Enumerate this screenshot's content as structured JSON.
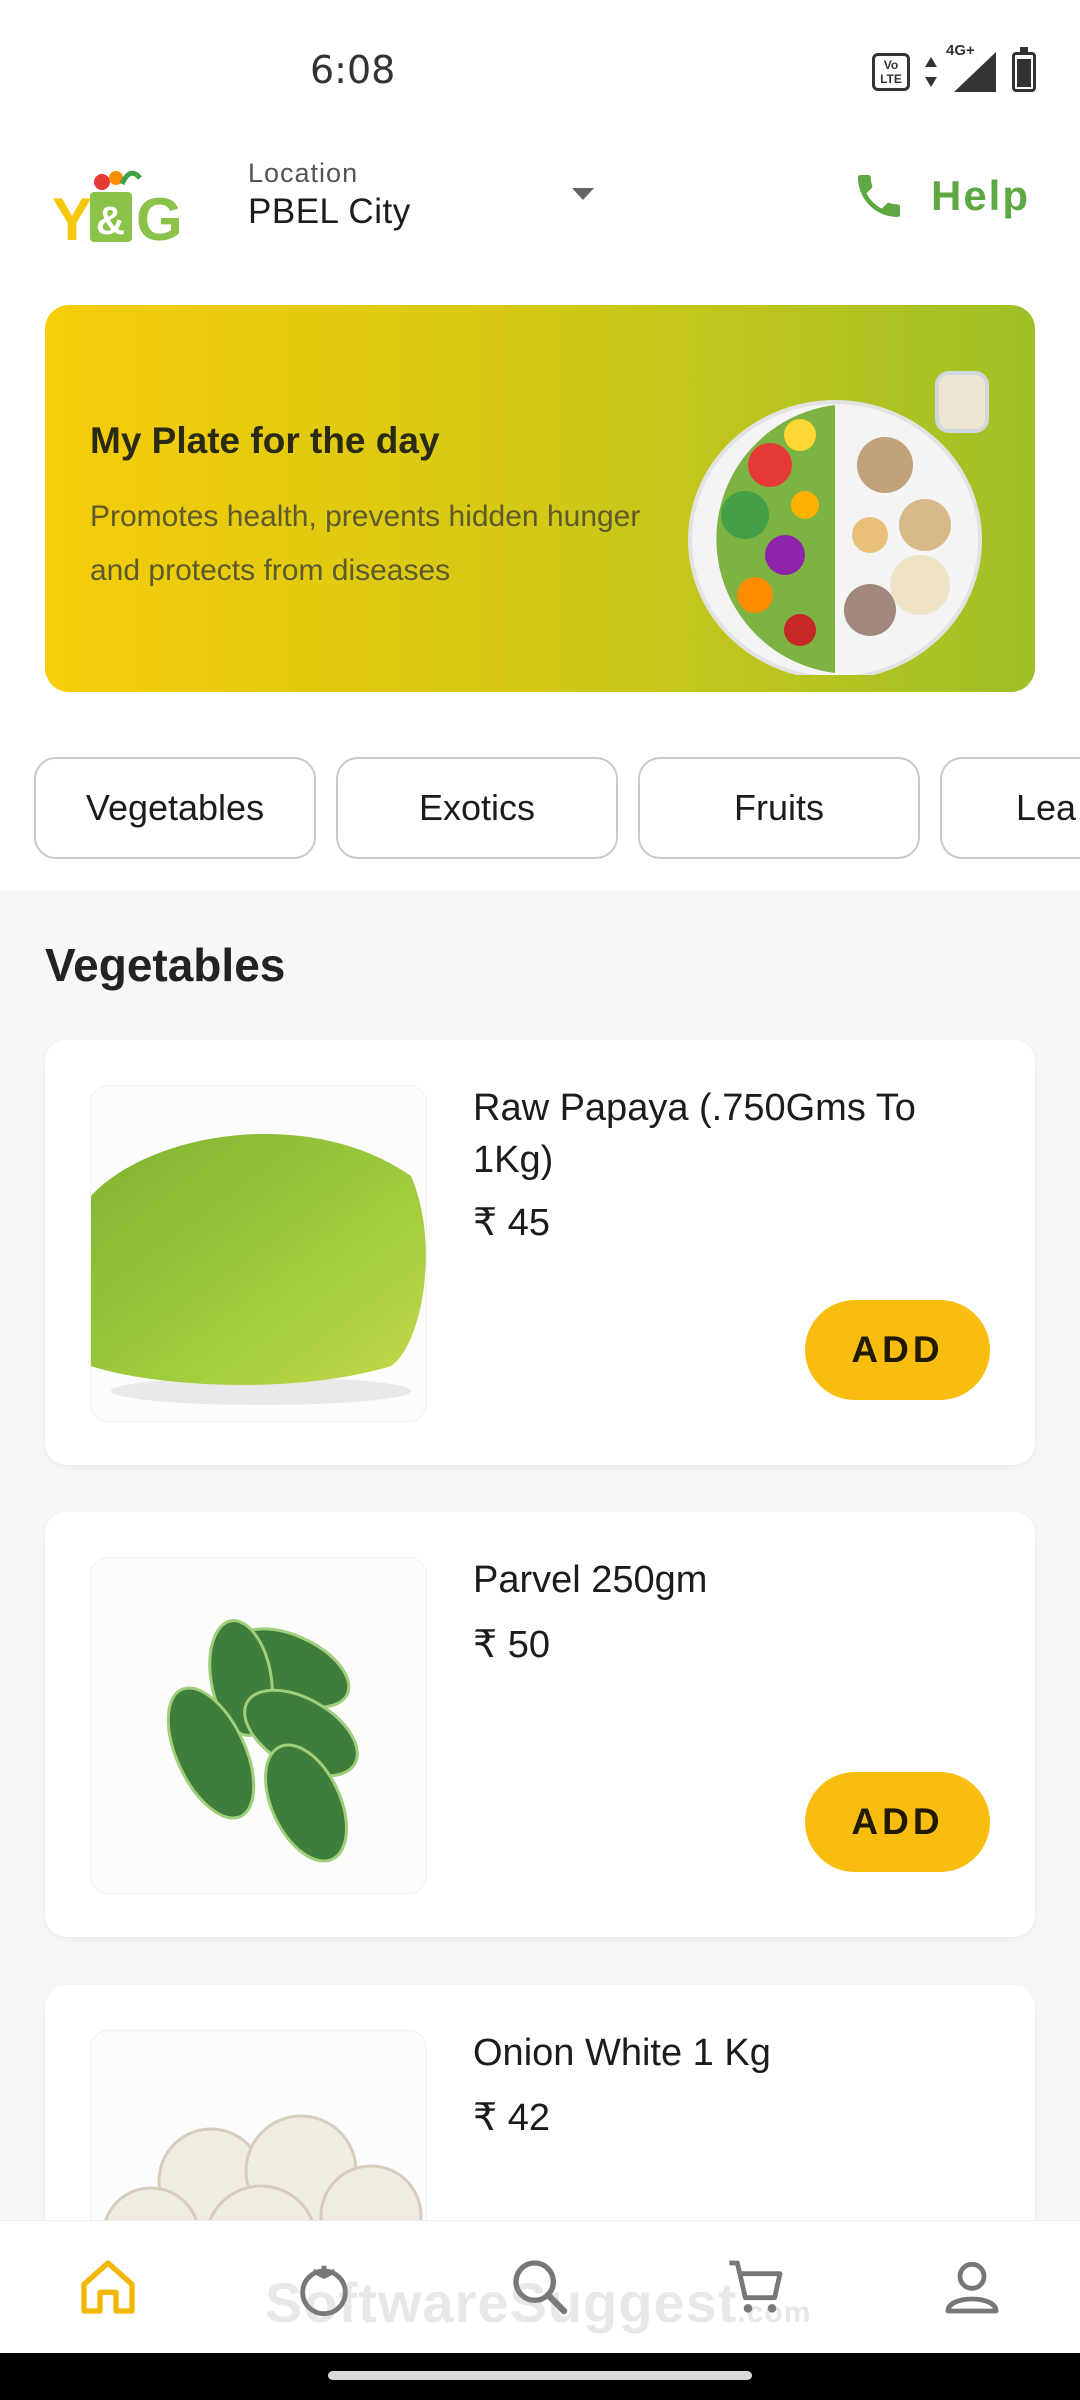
{
  "status_bar": {
    "time": "6:08",
    "network": "4G+",
    "volte_label": "Vo LTE",
    "icons": [
      "volte-icon",
      "data-arrows-icon",
      "signal-icon",
      "battery-icon"
    ]
  },
  "header": {
    "logo_text": "Y&G",
    "location_label": "Location",
    "location_value": "PBEL City",
    "help_label": "Help",
    "icons": [
      "logo",
      "caret-down-icon",
      "phone-icon"
    ],
    "accent_color": "#5ea843"
  },
  "banner": {
    "title": "My Plate for the day",
    "subtitle": "Promotes health, prevents hidden hunger and protects from diseases",
    "gradient": [
      "#f6cd08",
      "#9fc028"
    ]
  },
  "categories": [
    {
      "label": "Vegetables"
    },
    {
      "label": "Exotics"
    },
    {
      "label": "Fruits"
    },
    {
      "label": "Lea"
    }
  ],
  "section_title": "Vegetables",
  "products": [
    {
      "name": "Raw Papaya (.750Gms To 1Kg)",
      "price": "₹ 45",
      "button": "ADD",
      "image": "papaya"
    },
    {
      "name": "Parvel 250gm",
      "price": "₹ 50",
      "button": "ADD",
      "image": "parvel"
    },
    {
      "name": "Onion White 1 Kg",
      "price": "₹ 42",
      "image": "onion"
    }
  ],
  "add_button_color": "#f8bd0f",
  "bottom_nav": [
    {
      "icon": "home-icon",
      "active": true
    },
    {
      "icon": "tomato-icon"
    },
    {
      "icon": "search-icon"
    },
    {
      "icon": "cart-icon"
    },
    {
      "icon": "profile-icon"
    }
  ],
  "watermark": {
    "main": "SoftwareSuggest",
    "suffix": ".com"
  }
}
